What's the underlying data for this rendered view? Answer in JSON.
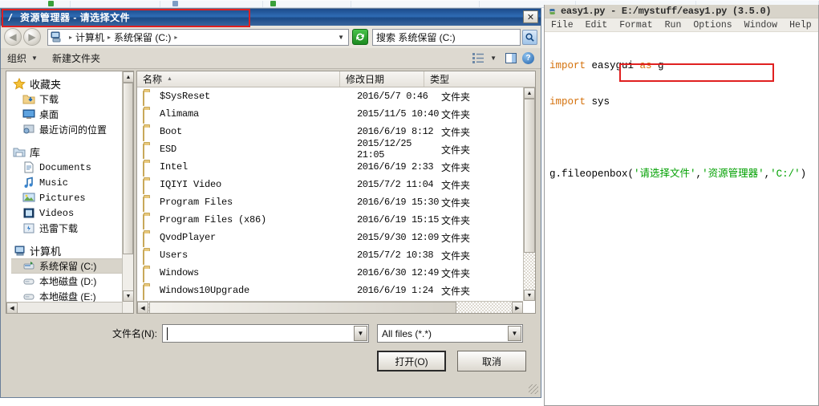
{
  "explorer": {
    "title": "资源管理器 - 请选择文件",
    "close_label": "✕",
    "nav": {
      "back": "◀",
      "forward": "▶"
    },
    "address": {
      "crumbs": [
        "计算机",
        "系统保留 (C:)"
      ],
      "separator": "▸",
      "dropdown": "▼",
      "refresh_icon": "refresh-icon"
    },
    "search": {
      "placeholder": "搜索 系统保留 (C:)",
      "icon": "search-icon"
    },
    "commandbar": {
      "organize": "组织",
      "organize_caret": "▼",
      "new_folder": "新建文件夹",
      "view_caret": "▼",
      "help": "?"
    },
    "tree": [
      {
        "label": "收藏夹",
        "icon": "star-icon",
        "level": 0
      },
      {
        "label": "下载",
        "icon": "downloads-icon",
        "level": 1
      },
      {
        "label": "桌面",
        "icon": "desktop-icon",
        "level": 1
      },
      {
        "label": "最近访问的位置",
        "icon": "recent-places-icon",
        "level": 1
      },
      {
        "label": "库",
        "icon": "library-icon",
        "level": 0
      },
      {
        "label": "Documents",
        "icon": "documents-icon",
        "level": 1
      },
      {
        "label": "Music",
        "icon": "music-icon",
        "level": 1
      },
      {
        "label": "Pictures",
        "icon": "pictures-icon",
        "level": 1
      },
      {
        "label": "Videos",
        "icon": "videos-icon",
        "level": 1
      },
      {
        "label": "迅雷下载",
        "icon": "thunder-download-icon",
        "level": 1
      },
      {
        "label": "计算机",
        "icon": "computer-icon",
        "level": 0
      },
      {
        "label": "系统保留 (C:)",
        "icon": "system-drive-icon",
        "level": 1,
        "selected": true
      },
      {
        "label": "本地磁盘 (D:)",
        "icon": "disk-icon",
        "level": 1
      },
      {
        "label": "本地磁盘 (E:)",
        "icon": "disk-icon",
        "level": 1
      }
    ],
    "columns": [
      "名称",
      "修改日期",
      "类型"
    ],
    "sort_indicator": "▲",
    "rows": [
      {
        "name": "$SysReset",
        "date": "2016/5/7 0:46",
        "type": "文件夹"
      },
      {
        "name": "Alimama",
        "date": "2015/11/5 10:40",
        "type": "文件夹"
      },
      {
        "name": "Boot",
        "date": "2016/6/19 8:12",
        "type": "文件夹"
      },
      {
        "name": "ESD",
        "date": "2015/12/25 21:05",
        "type": "文件夹"
      },
      {
        "name": "Intel",
        "date": "2016/6/19 2:33",
        "type": "文件夹"
      },
      {
        "name": "IQIYI Video",
        "date": "2015/7/2 11:04",
        "type": "文件夹"
      },
      {
        "name": "Program Files",
        "date": "2016/6/19 15:30",
        "type": "文件夹"
      },
      {
        "name": "Program Files (x86)",
        "date": "2016/6/19 15:15",
        "type": "文件夹"
      },
      {
        "name": "QvodPlayer",
        "date": "2015/9/30 12:09",
        "type": "文件夹"
      },
      {
        "name": "Users",
        "date": "2015/7/2 10:38",
        "type": "文件夹"
      },
      {
        "name": "Windows",
        "date": "2016/6/30 12:49",
        "type": "文件夹"
      },
      {
        "name": "Windows10Upgrade",
        "date": "2016/6/19 1:24",
        "type": "文件夹"
      }
    ],
    "footer": {
      "filename_label": "文件名(N):",
      "filename_value": "",
      "filter_value": "All files (*.*)",
      "open_button": "打开(O)",
      "cancel_button": "取消",
      "combo_caret": "▼"
    }
  },
  "idle": {
    "title": "easy1.py - E:/mystuff/easy1.py (3.5.0)",
    "menu": [
      "File",
      "Edit",
      "Format",
      "Run",
      "Options",
      "Window",
      "Help"
    ],
    "code": {
      "line1_kw": "import",
      "line1_mod": " easygui ",
      "line1_as": "as",
      "line1_alias": " g",
      "line2_kw": "import",
      "line2_mod": " sys",
      "line4_call": "g.fileopenbox(",
      "line4_arg1": "'请选择文件'",
      "line4_comma1": ",",
      "line4_arg2": "'资源管理器'",
      "line4_comma2": ",",
      "line4_arg3": "'C:/'",
      "line4_close": ")"
    }
  },
  "annotations": {
    "title_highlight_color": "#e02020",
    "code_highlight_color": "#e02020"
  }
}
